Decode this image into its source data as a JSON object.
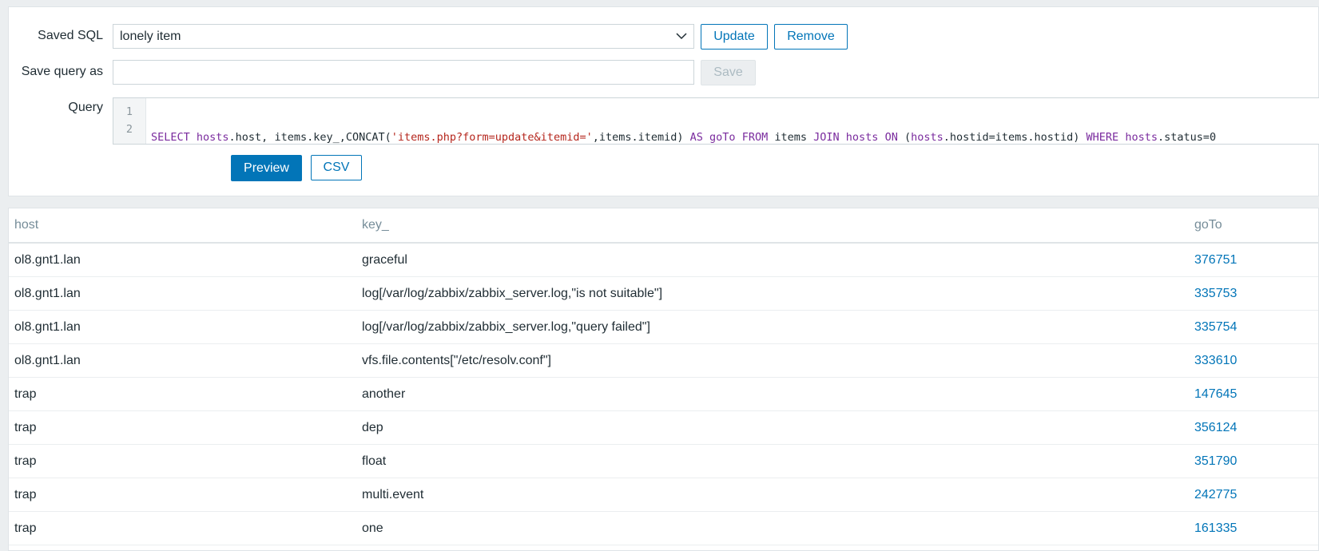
{
  "form": {
    "saved_sql_label": "Saved SQL",
    "saved_sql_value": "lonely item",
    "update_label": "Update",
    "remove_label": "Remove",
    "save_query_as_label": "Save query as",
    "save_query_as_value": "",
    "save_label": "Save",
    "query_label": "Query",
    "query_line_numbers": [
      "1",
      "2"
    ],
    "preview_label": "Preview",
    "csv_label": "CSV"
  },
  "query_tokens": [
    {
      "t": "SELECT ",
      "c": "kw"
    },
    {
      "t": "hosts",
      "c": "kw"
    },
    {
      "t": ".host, items.key_,CONCAT(",
      "c": "plain"
    },
    {
      "t": "'items.php?form=update&itemid='",
      "c": "str"
    },
    {
      "t": ",items.itemid) ",
      "c": "plain"
    },
    {
      "t": "AS",
      "c": "kw"
    },
    {
      "t": " ",
      "c": "plain"
    },
    {
      "t": "goTo",
      "c": "kw"
    },
    {
      "t": " ",
      "c": "plain"
    },
    {
      "t": "FROM",
      "c": "kw"
    },
    {
      "t": " items ",
      "c": "plain"
    },
    {
      "t": "JOIN",
      "c": "kw"
    },
    {
      "t": " ",
      "c": "plain"
    },
    {
      "t": "hosts",
      "c": "kw"
    },
    {
      "t": " ",
      "c": "plain"
    },
    {
      "t": "ON",
      "c": "kw"
    },
    {
      "t": " (",
      "c": "plain"
    },
    {
      "t": "hosts",
      "c": "kw"
    },
    {
      "t": ".hostid=items.hostid) ",
      "c": "plain"
    },
    {
      "t": "WHERE",
      "c": "kw"
    },
    {
      "t": " ",
      "c": "plain"
    },
    {
      "t": "hosts",
      "c": "kw"
    },
    {
      "t": ".status=0",
      "c": "plain"
    }
  ],
  "table": {
    "headers": [
      "host",
      "key_",
      "goTo"
    ],
    "rows": [
      {
        "host": "ol8.gnt1.lan",
        "key": "graceful",
        "goto": "376751"
      },
      {
        "host": "ol8.gnt1.lan",
        "key": "log[/var/log/zabbix/zabbix_server.log,\"is not suitable\"]",
        "goto": "335753"
      },
      {
        "host": "ol8.gnt1.lan",
        "key": "log[/var/log/zabbix/zabbix_server.log,\"query failed\"]",
        "goto": "335754"
      },
      {
        "host": "ol8.gnt1.lan",
        "key": "vfs.file.contents[\"/etc/resolv.conf\"]",
        "goto": "333610"
      },
      {
        "host": "trap",
        "key": "another",
        "goto": "147645"
      },
      {
        "host": "trap",
        "key": "dep",
        "goto": "356124"
      },
      {
        "host": "trap",
        "key": "float",
        "goto": "351790"
      },
      {
        "host": "trap",
        "key": "multi.event",
        "goto": "242775"
      },
      {
        "host": "trap",
        "key": "one",
        "goto": "161335"
      }
    ]
  },
  "colors": {
    "accent": "#0275b8",
    "keyword": "#7a2b9e",
    "string": "#b5261d"
  }
}
